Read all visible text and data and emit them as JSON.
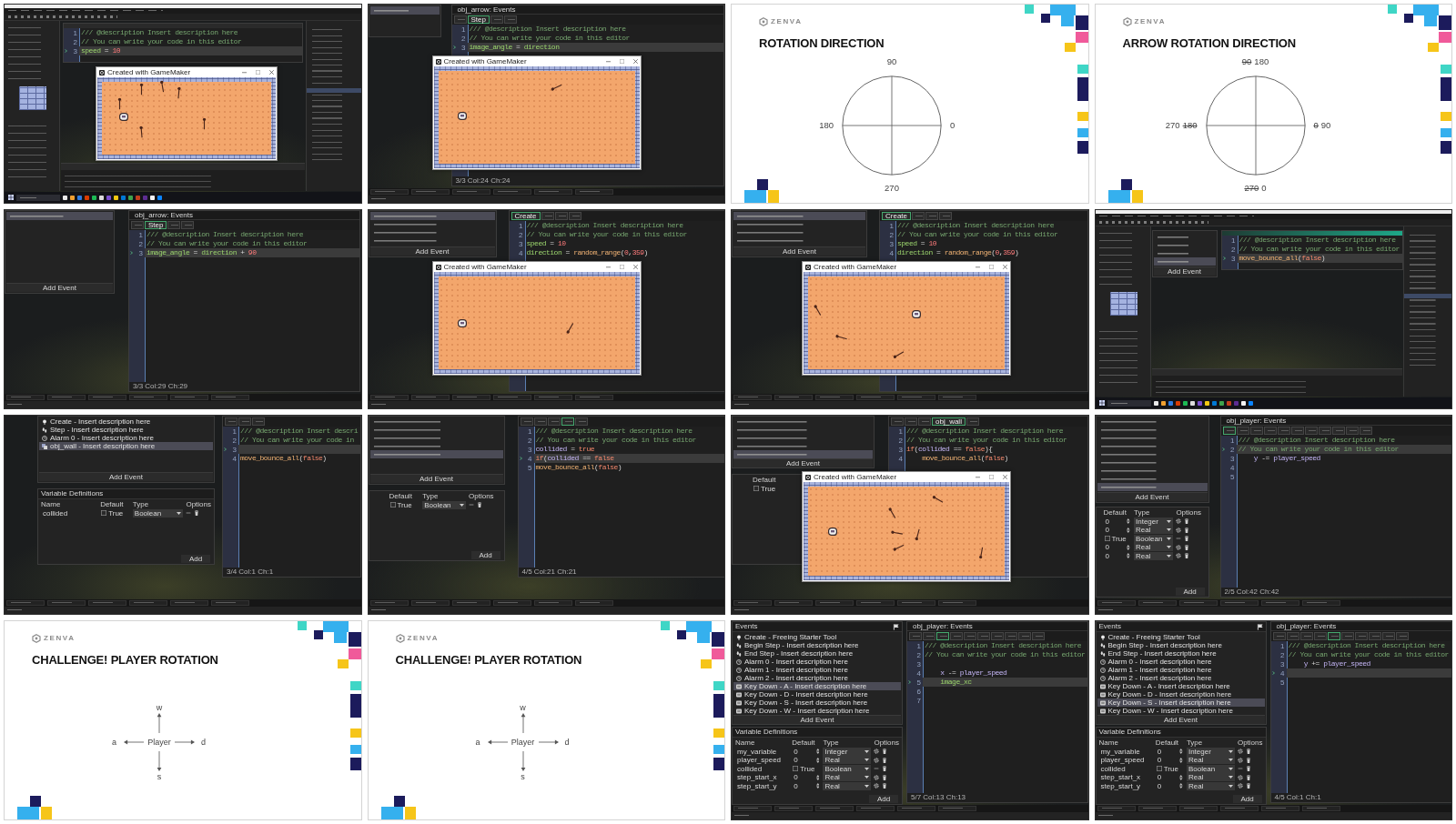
{
  "tiles": [
    {
      "kind": "desktop",
      "editor": {
        "lines": [
          {
            "number": "1",
            "tokens": [
              {
                "kind": "comment",
                "text": "/// @description Insert description here"
              }
            ],
            "current": false
          },
          {
            "number": "2",
            "tokens": [
              {
                "kind": "comment",
                "text": "// You can write your code in this editor"
              }
            ],
            "current": false
          },
          {
            "number": "3",
            "tokens": [
              {
                "kind": "builtin",
                "text": "speed"
              },
              {
                "kind": "plain",
                "text": " = "
              },
              {
                "kind": "number",
                "text": "10"
              }
            ],
            "current": true
          }
        ]
      },
      "game": {
        "title": "Created with GameMaker"
      }
    },
    {
      "kind": "ide",
      "events": {
        "items": [
          {
            "selected": true
          }
        ]
      },
      "editor": {
        "title": "obj_arrow: Events",
        "tabs": [
          {
            "selected": false
          },
          {
            "label": "Step",
            "selected": true
          },
          {
            "selected": false
          },
          {
            "selected": false
          }
        ],
        "lines": [
          {
            "number": "1",
            "tokens": [
              {
                "kind": "comment",
                "text": "/// @description Insert description here"
              }
            ],
            "current": false
          },
          {
            "number": "2",
            "tokens": [
              {
                "kind": "comment",
                "text": "// You can write your code in this editor"
              }
            ],
            "current": false
          },
          {
            "number": "3",
            "tokens": [
              {
                "kind": "builtin",
                "text": "image_angle"
              },
              {
                "kind": "plain",
                "text": " = "
              },
              {
                "kind": "builtin",
                "text": "direction"
              }
            ],
            "current": true
          }
        ],
        "status": "3/3 Col:24 Ch:24"
      },
      "game": {
        "title": "Created with GameMaker"
      }
    },
    {
      "kind": "slide",
      "logo": "ZENVA",
      "title": "ROTATION DIRECTION",
      "diagram": {
        "kind": "circle",
        "labels": [
          {
            "kind": "top",
            "parts": [
              {
                "text": "90",
                "struck": false
              }
            ]
          },
          {
            "kind": "left",
            "parts": [
              {
                "text": "180",
                "struck": false
              }
            ]
          },
          {
            "kind": "right",
            "parts": [
              {
                "text": "0",
                "struck": false
              }
            ]
          },
          {
            "kind": "bottom",
            "parts": [
              {
                "text": "270",
                "struck": false
              }
            ]
          }
        ]
      }
    },
    {
      "kind": "slide",
      "logo": "ZENVA",
      "title": "ARROW ROTATION DIRECTION",
      "diagram": {
        "kind": "circle",
        "labels": [
          {
            "kind": "top",
            "parts": [
              {
                "text": "90",
                "struck": true
              },
              {
                "text": "180",
                "struck": false
              }
            ]
          },
          {
            "kind": "left",
            "parts": [
              {
                "text": "270",
                "struck": false
              },
              {
                "text": "180",
                "struck": true
              }
            ]
          },
          {
            "kind": "right",
            "parts": [
              {
                "text": "0",
                "struck": true
              },
              {
                "text": "90",
                "struck": false
              }
            ]
          },
          {
            "kind": "bottom",
            "parts": [
              {
                "text": "270",
                "struck": true
              },
              {
                "text": "0",
                "struck": false
              }
            ]
          }
        ]
      }
    },
    {
      "kind": "ide",
      "events": {
        "items": [
          {
            "selected": true
          }
        ],
        "add_label": "Add Event"
      },
      "editor": {
        "title": "obj_arrow: Events",
        "tabs": [
          {
            "selected": false
          },
          {
            "label": "Step",
            "selected": true
          },
          {
            "selected": false
          },
          {
            "selected": false
          }
        ],
        "lines": [
          {
            "number": "1",
            "tokens": [
              {
                "kind": "comment",
                "text": "/// @description Insert description here"
              }
            ],
            "current": false
          },
          {
            "number": "2",
            "tokens": [
              {
                "kind": "comment",
                "text": "// You can write your code in this editor"
              }
            ],
            "current": false
          },
          {
            "number": "3",
            "tokens": [
              {
                "kind": "builtin",
                "text": "image_angle"
              },
              {
                "kind": "plain",
                "text": " = "
              },
              {
                "kind": "builtin",
                "text": "direction"
              },
              {
                "kind": "plain",
                "text": " + "
              },
              {
                "kind": "number",
                "text": "90"
              }
            ],
            "current": true
          }
        ],
        "status": "3/3 Col:29 Ch:29"
      }
    },
    {
      "kind": "ide",
      "events": {
        "items": [
          {
            "selected": true
          },
          {
            "selected": false
          },
          {
            "selected": false
          },
          {
            "selected": false
          }
        ],
        "add_label": "Add Event"
      },
      "editor": {
        "tabs": [
          {
            "label": "Create",
            "selected": true
          },
          {
            "selected": false
          },
          {
            "selected": false
          },
          {
            "selected": false
          }
        ],
        "lines": [
          {
            "number": "1",
            "tokens": [
              {
                "kind": "comment",
                "text": "/// @description Insert description here"
              }
            ],
            "current": false
          },
          {
            "number": "2",
            "tokens": [
              {
                "kind": "comment",
                "text": "// You can write your code in this editor"
              }
            ],
            "current": false
          },
          {
            "number": "3",
            "tokens": [
              {
                "kind": "builtin",
                "text": "speed"
              },
              {
                "kind": "plain",
                "text": " = "
              },
              {
                "kind": "number",
                "text": "10"
              }
            ],
            "current": false
          },
          {
            "number": "4",
            "tokens": [
              {
                "kind": "builtin",
                "text": "direction"
              },
              {
                "kind": "plain",
                "text": " = "
              },
              {
                "kind": "function",
                "text": "random_range"
              },
              {
                "kind": "plain",
                "text": "("
              },
              {
                "kind": "number",
                "text": "0"
              },
              {
                "kind": "plain",
                "text": ","
              },
              {
                "kind": "number",
                "text": "359"
              },
              {
                "kind": "plain",
                "text": ")"
              }
            ],
            "current": false
          }
        ]
      },
      "game": {
        "title": "Created with GameMaker"
      }
    },
    {
      "kind": "ide",
      "events": {
        "items": [
          {
            "selected": true
          },
          {
            "selected": false
          },
          {
            "selected": false
          },
          {
            "selected": false
          }
        ],
        "add_label": "Add Event"
      },
      "editor": {
        "tabs": [
          {
            "label": "Create",
            "selected": true
          },
          {
            "selected": false
          },
          {
            "selected": false
          },
          {
            "selected": false
          }
        ],
        "lines": [
          {
            "number": "1",
            "tokens": [
              {
                "kind": "comment",
                "text": "/// @description Insert description here"
              }
            ],
            "current": false
          },
          {
            "number": "2",
            "tokens": [
              {
                "kind": "comment",
                "text": "// You can write your code in this editor"
              }
            ],
            "current": false
          },
          {
            "number": "3",
            "tokens": [
              {
                "kind": "builtin",
                "text": "speed"
              },
              {
                "kind": "plain",
                "text": " = "
              },
              {
                "kind": "number",
                "text": "10"
              }
            ],
            "current": false
          },
          {
            "number": "4",
            "tokens": [
              {
                "kind": "builtin",
                "text": "direction"
              },
              {
                "kind": "plain",
                "text": " = "
              },
              {
                "kind": "function",
                "text": "random_range"
              },
              {
                "kind": "plain",
                "text": "("
              },
              {
                "kind": "number",
                "text": "0"
              },
              {
                "kind": "plain",
                "text": ","
              },
              {
                "kind": "number",
                "text": "359"
              },
              {
                "kind": "plain",
                "text": ")"
              }
            ],
            "current": false
          }
        ]
      },
      "game": {
        "title": "Created with GameMaker"
      }
    },
    {
      "kind": "desktop",
      "events": {
        "items": [
          {
            "selected": false
          },
          {
            "selected": false
          },
          {
            "selected": false
          },
          {
            "selected": true
          }
        ],
        "add_label": "Add Event"
      },
      "editor": {
        "lines": [
          {
            "number": "1",
            "tokens": [
              {
                "kind": "comment",
                "text": "/// @description Insert description here"
              }
            ],
            "current": false
          },
          {
            "number": "2",
            "tokens": [
              {
                "kind": "comment",
                "text": "// You can write your code in this editor"
              }
            ],
            "current": false
          },
          {
            "number": "3",
            "tokens": [
              {
                "kind": "function",
                "text": "move_bounce_all"
              },
              {
                "kind": "plain",
                "text": "("
              },
              {
                "kind": "keyword",
                "text": "false"
              },
              {
                "kind": "plain",
                "text": ")"
              }
            ],
            "current": true
          }
        ]
      }
    },
    {
      "kind": "ide",
      "events": {
        "items": [
          {
            "kind": "create",
            "label": "Create - Insert description here",
            "selected": false
          },
          {
            "kind": "step",
            "label": "Step - Insert description here",
            "selected": false
          },
          {
            "kind": "alarm",
            "label": "Alarm 0 - Insert description here",
            "selected": false
          },
          {
            "kind": "collision",
            "label": "obj_wall - Insert description here",
            "selected": true
          }
        ],
        "add_label": "Add Event"
      },
      "variables": {
        "title": "Variable Definitions",
        "columns": [
          "Name",
          "Default",
          "Type",
          "Options"
        ],
        "rows": [
          {
            "kind": "boolean",
            "checked": false,
            "cells": [
              "collided",
              "True",
              "Boolean"
            ]
          }
        ],
        "add_label": "Add"
      },
      "editor": {
        "tabs": [
          {
            "selected": false
          },
          {
            "selected": false
          },
          {
            "selected": false
          }
        ],
        "lines": [
          {
            "number": "1",
            "tokens": [
              {
                "kind": "comment",
                "text": "/// @description Insert descri"
              }
            ],
            "current": false
          },
          {
            "number": "2",
            "tokens": [
              {
                "kind": "comment",
                "text": "// You can write your code in"
              }
            ],
            "current": false
          },
          {
            "number": "3",
            "current": true
          },
          {
            "number": "4",
            "tokens": [
              {
                "kind": "function",
                "text": "move_bounce_all"
              },
              {
                "kind": "plain",
                "text": "("
              },
              {
                "kind": "keyword",
                "text": "false"
              },
              {
                "kind": "plain",
                "text": ")"
              }
            ],
            "current": false
          }
        ],
        "status": "3/4 Col:1 Ch:1"
      }
    },
    {
      "kind": "ide",
      "events": {
        "items": [
          {
            "selected": false
          },
          {
            "selected": false
          },
          {
            "selected": false
          },
          {
            "selected": false
          },
          {
            "selected": true
          }
        ],
        "add_label": "Add Event"
      },
      "variables": {
        "columns": [
          "Default",
          "Type",
          "Options"
        ],
        "rows": [
          {
            "kind": "boolean",
            "checked": false,
            "cells": [
              "True",
              "Boolean"
            ]
          }
        ],
        "add_label": "Add"
      },
      "editor": {
        "tabs": [
          {
            "selected": false
          },
          {
            "selected": false
          },
          {
            "selected": false
          },
          {
            "selected": true
          },
          {
            "selected": false
          }
        ],
        "lines": [
          {
            "number": "1",
            "tokens": [
              {
                "kind": "comment",
                "text": "/// @description Insert description here"
              }
            ],
            "current": false
          },
          {
            "number": "2",
            "tokens": [
              {
                "kind": "comment",
                "text": "// You can write your code in this editor"
              }
            ],
            "current": false
          },
          {
            "number": "3",
            "tokens": [
              {
                "kind": "instance",
                "text": "collided"
              },
              {
                "kind": "plain",
                "text": " = "
              },
              {
                "kind": "keyword",
                "text": "true"
              }
            ],
            "current": false
          },
          {
            "number": "4",
            "tokens": [
              {
                "kind": "keyword",
                "text": "if"
              },
              {
                "kind": "plain",
                "text": "("
              },
              {
                "kind": "instance",
                "text": "collided"
              },
              {
                "kind": "plain",
                "text": " == "
              },
              {
                "kind": "keyword",
                "text": "false"
              }
            ],
            "current": true
          },
          {
            "number": "5",
            "tokens": [
              {
                "kind": "function",
                "text": "move_bounce_all"
              },
              {
                "kind": "plain",
                "text": "("
              },
              {
                "kind": "keyword",
                "text": "false"
              },
              {
                "kind": "plain",
                "text": ")"
              }
            ],
            "current": false
          }
        ],
        "status": "4/5 Col:21 Ch:21"
      }
    },
    {
      "kind": "ide",
      "events": {
        "items": [
          {
            "selected": false
          },
          {
            "selected": false
          },
          {
            "selected": false
          },
          {
            "selected": false
          },
          {
            "selected": true
          }
        ],
        "add_label": "Add Event"
      },
      "variables": {
        "columns": [
          "Default"
        ],
        "rows": [
          {
            "kind": "boolean",
            "checked": false,
            "cells": [
              "True"
            ]
          }
        ]
      },
      "editor": {
        "tabs": [
          {
            "selected": false
          },
          {
            "selected": false
          },
          {
            "selected": false
          },
          {
            "label": "obj_wall",
            "selected": true
          },
          {
            "selected": false
          }
        ],
        "lines": [
          {
            "number": "1",
            "tokens": [
              {
                "kind": "comment",
                "text": "/// @description Insert description here"
              }
            ],
            "current": false
          },
          {
            "number": "2",
            "tokens": [
              {
                "kind": "comment",
                "text": "// You can write your code in this editor"
              }
            ],
            "current": false
          },
          {
            "number": "3",
            "tokens": [
              {
                "kind": "keyword",
                "text": "if"
              },
              {
                "kind": "plain",
                "text": "("
              },
              {
                "kind": "instance",
                "text": "collided"
              },
              {
                "kind": "plain",
                "text": " == "
              },
              {
                "kind": "keyword",
                "text": "false"
              },
              {
                "kind": "plain",
                "text": "){"
              }
            ],
            "current": false
          },
          {
            "number": "4",
            "tokens": [
              {
                "kind": "function",
                "text": "    move_bounce_all"
              },
              {
                "kind": "plain",
                "text": "("
              },
              {
                "kind": "keyword",
                "text": "false"
              },
              {
                "kind": "plain",
                "text": ")"
              }
            ],
            "current": false
          }
        ]
      },
      "game": {
        "title": "Created with GameMaker"
      }
    },
    {
      "kind": "ide",
      "events": {
        "items": [
          {
            "selected": false
          },
          {
            "selected": false
          },
          {
            "selected": false
          },
          {
            "selected": false
          },
          {
            "selected": false
          },
          {
            "selected": false
          },
          {
            "selected": false
          },
          {
            "selected": false
          },
          {
            "selected": true
          }
        ],
        "add_label": "Add Event"
      },
      "variables": {
        "columns": [
          "Default",
          "Type",
          "Options"
        ],
        "rows": [
          {
            "kind": "number",
            "cells": [
              "0",
              "Integer"
            ]
          },
          {
            "kind": "number",
            "cells": [
              "0",
              "Real"
            ]
          },
          {
            "kind": "boolean",
            "checked": false,
            "cells": [
              "True",
              "Boolean"
            ]
          },
          {
            "kind": "number",
            "cells": [
              "0",
              "Real"
            ]
          },
          {
            "kind": "number",
            "cells": [
              "0",
              "Real"
            ]
          }
        ],
        "add_label": "Add"
      },
      "editor": {
        "title": "obj_player: Events",
        "tabs": [
          {
            "selected": true
          },
          {
            "selected": false
          },
          {
            "selected": false
          },
          {
            "selected": false
          },
          {
            "selected": false
          },
          {
            "selected": false
          },
          {
            "selected": false
          },
          {
            "selected": false
          },
          {
            "selected": false
          },
          {
            "selected": false
          },
          {
            "selected": false
          }
        ],
        "lines": [
          {
            "number": "1",
            "tokens": [
              {
                "kind": "comment",
                "text": "/// @description Insert description here"
              }
            ],
            "current": false
          },
          {
            "number": "2",
            "tokens": [
              {
                "kind": "comment",
                "text": "// You can write your code in this editor"
              }
            ],
            "current": true
          },
          {
            "number": "3",
            "tokens": [
              {
                "kind": "instance",
                "text": "    y"
              },
              {
                "kind": "plain",
                "text": " -= "
              },
              {
                "kind": "instance",
                "text": "player_speed"
              }
            ],
            "current": false
          },
          {
            "number": "4",
            "current": false
          },
          {
            "number": "5",
            "current": false
          }
        ],
        "status": "2/5 Col:42 Ch:42"
      }
    },
    {
      "kind": "slide",
      "logo": "ZENVA",
      "title": "CHALLENGE! PLAYER ROTATION",
      "diagram": {
        "kind": "keys",
        "center": "Player",
        "labels": [
          {
            "kind": "top",
            "text": "w"
          },
          {
            "kind": "left",
            "text": "a"
          },
          {
            "kind": "right",
            "text": "d"
          },
          {
            "kind": "bottom",
            "text": "s"
          }
        ]
      }
    },
    {
      "kind": "slide",
      "logo": "ZENVA",
      "title": "CHALLENGE! PLAYER ROTATION",
      "diagram": {
        "kind": "keys",
        "center": "Player",
        "labels": [
          {
            "kind": "top",
            "text": "w"
          },
          {
            "kind": "left",
            "text": "a"
          },
          {
            "kind": "right",
            "text": "d"
          },
          {
            "kind": "bottom",
            "text": "s"
          }
        ]
      }
    },
    {
      "kind": "ide",
      "events": {
        "title": "Events",
        "items": [
          {
            "kind": "create",
            "label": "Create - Freeing Starter Tool",
            "selected": false
          },
          {
            "kind": "step",
            "label": "Begin Step - Insert description here",
            "selected": false
          },
          {
            "kind": "step",
            "label": "End Step - Insert description here",
            "selected": false
          },
          {
            "kind": "alarm",
            "label": "Alarm 0 - Insert description here",
            "selected": false
          },
          {
            "kind": "alarm",
            "label": "Alarm 1 - Insert description here",
            "selected": false
          },
          {
            "kind": "alarm",
            "label": "Alarm 2 - Insert description here",
            "selected": false
          },
          {
            "kind": "key",
            "label": "Key Down - A - Insert description here",
            "selected": true
          },
          {
            "kind": "key",
            "label": "Key Down - D - Insert description here",
            "selected": false
          },
          {
            "kind": "key",
            "label": "Key Down - S - Insert description here",
            "selected": false
          },
          {
            "kind": "key",
            "label": "Key Down - W - Insert description here",
            "selected": false
          }
        ],
        "add_label": "Add Event"
      },
      "variables": {
        "title": "Variable Definitions",
        "columns": [
          "Name",
          "Default",
          "Type",
          "Options"
        ],
        "rows": [
          {
            "kind": "number",
            "cells": [
              "my_variable",
              "0",
              "Integer"
            ]
          },
          {
            "kind": "number",
            "cells": [
              "player_speed",
              "0",
              "Real"
            ]
          },
          {
            "kind": "boolean",
            "checked": false,
            "cells": [
              "collided",
              "True",
              "Boolean"
            ]
          },
          {
            "kind": "number",
            "cells": [
              "step_start_x",
              "0",
              "Real"
            ]
          },
          {
            "kind": "number",
            "cells": [
              "step_start_y",
              "0",
              "Real"
            ]
          }
        ],
        "add_label": "Add"
      },
      "editor": {
        "title": "obj_player: Events",
        "tabs": [
          {
            "selected": false
          },
          {
            "selected": false
          },
          {
            "selected": true
          },
          {
            "selected": false
          },
          {
            "selected": false
          },
          {
            "selected": false
          },
          {
            "selected": false
          },
          {
            "selected": false
          },
          {
            "selected": false
          },
          {
            "selected": false
          }
        ],
        "lines": [
          {
            "number": "1",
            "tokens": [
              {
                "kind": "comment",
                "text": "/// @description Insert description here"
              }
            ],
            "current": false
          },
          {
            "number": "2",
            "tokens": [
              {
                "kind": "comment",
                "text": "// You can write your code in this editor"
              }
            ],
            "current": false
          },
          {
            "number": "3",
            "current": false
          },
          {
            "number": "4",
            "tokens": [
              {
                "kind": "instance",
                "text": "    x"
              },
              {
                "kind": "plain",
                "text": " -= "
              },
              {
                "kind": "instance",
                "text": "player_speed"
              }
            ],
            "current": false
          },
          {
            "number": "5",
            "tokens": [
              {
                "kind": "builtin",
                "text": "    image_xc"
              }
            ],
            "current": true
          },
          {
            "number": "6",
            "current": false
          },
          {
            "number": "7",
            "current": false
          }
        ],
        "status": "5/7 Col:13 Ch:13"
      }
    },
    {
      "kind": "ide",
      "events": {
        "title": "Events",
        "items": [
          {
            "kind": "create",
            "label": "Create - Freeing Starter Tool",
            "selected": false
          },
          {
            "kind": "step",
            "label": "Begin Step - Insert description here",
            "selected": false
          },
          {
            "kind": "step",
            "label": "End Step - Insert description here",
            "selected": false
          },
          {
            "kind": "alarm",
            "label": "Alarm 0 - Insert description here",
            "selected": false
          },
          {
            "kind": "alarm",
            "label": "Alarm 1 - Insert description here",
            "selected": false
          },
          {
            "kind": "alarm",
            "label": "Alarm 2 - Insert description here",
            "selected": false
          },
          {
            "kind": "key",
            "label": "Key Down - A - Insert description here",
            "selected": false
          },
          {
            "kind": "key",
            "label": "Key Down - D - Insert description here",
            "selected": false
          },
          {
            "kind": "key",
            "label": "Key Down - S - Insert description here",
            "selected": true
          },
          {
            "kind": "key",
            "label": "Key Down - W - Insert description here",
            "selected": false
          }
        ],
        "add_label": "Add Event"
      },
      "variables": {
        "title": "Variable Definitions",
        "columns": [
          "Name",
          "Default",
          "Type",
          "Options"
        ],
        "rows": [
          {
            "kind": "number",
            "cells": [
              "my_variable",
              "0",
              "Integer"
            ]
          },
          {
            "kind": "number",
            "cells": [
              "player_speed",
              "0",
              "Real"
            ]
          },
          {
            "kind": "boolean",
            "checked": false,
            "cells": [
              "collided",
              "True",
              "Boolean"
            ]
          },
          {
            "kind": "number",
            "cells": [
              "step_start_x",
              "0",
              "Real"
            ]
          },
          {
            "kind": "number",
            "cells": [
              "step_start_y",
              "0",
              "Real"
            ]
          }
        ],
        "add_label": "Add"
      },
      "editor": {
        "title": "obj_player: Events",
        "tabs": [
          {
            "selected": false
          },
          {
            "selected": false
          },
          {
            "selected": false
          },
          {
            "selected": false
          },
          {
            "selected": true
          },
          {
            "selected": false
          },
          {
            "selected": false
          },
          {
            "selected": false
          },
          {
            "selected": false
          },
          {
            "selected": false
          }
        ],
        "lines": [
          {
            "number": "1",
            "tokens": [
              {
                "kind": "comment",
                "text": "/// @description Insert description here"
              }
            ],
            "current": false
          },
          {
            "number": "2",
            "tokens": [
              {
                "kind": "comment",
                "text": "// You can write your code in this editor"
              }
            ],
            "current": false
          },
          {
            "number": "3",
            "tokens": [
              {
                "kind": "instance",
                "text": "    y"
              },
              {
                "kind": "plain",
                "text": " += "
              },
              {
                "kind": "instance",
                "text": "player_speed"
              }
            ],
            "current": false
          },
          {
            "number": "4",
            "current": true
          },
          {
            "number": "5",
            "current": false
          }
        ],
        "status": "4/5 Col:1 Ch:1"
      }
    }
  ]
}
